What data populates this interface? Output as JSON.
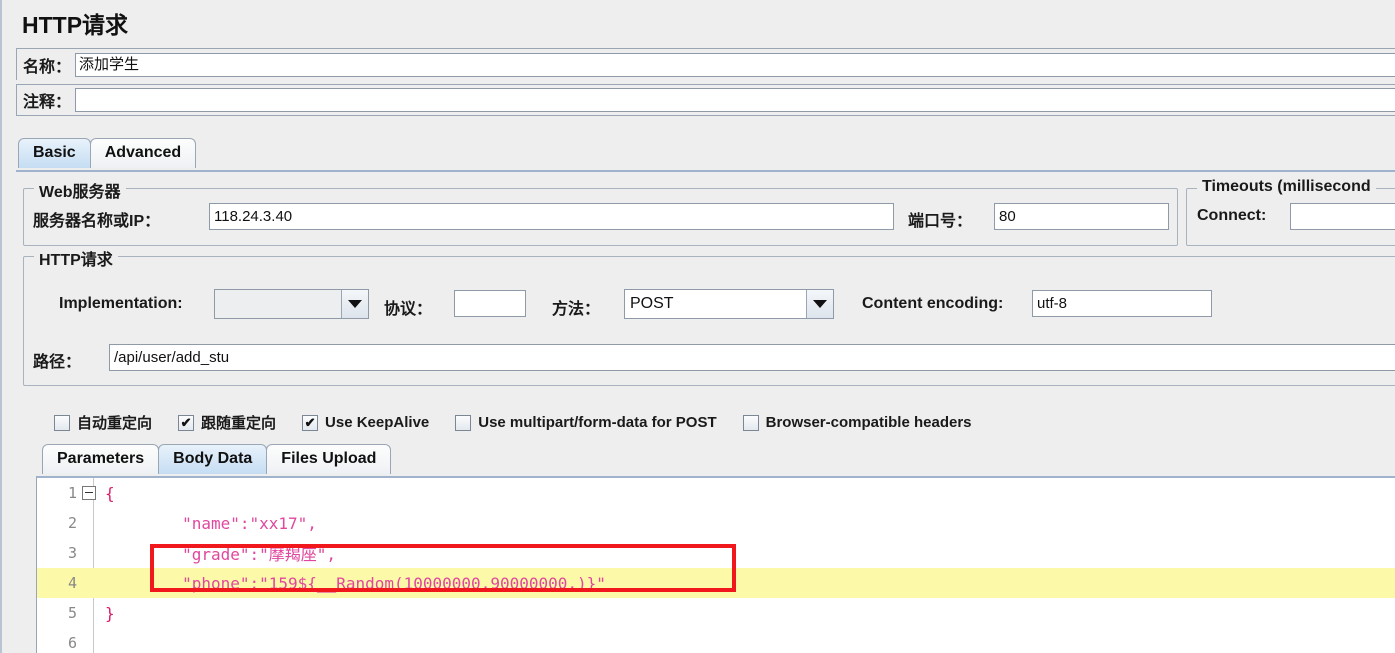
{
  "page_title": "HTTP请求",
  "fields": {
    "name_label": "名称：",
    "name_value": "添加学生",
    "comment_label": "注释：",
    "comment_value": ""
  },
  "main_tabs": [
    {
      "label": "Basic",
      "selected": true
    },
    {
      "label": "Advanced",
      "selected": false
    }
  ],
  "web_server": {
    "group_title": "Web服务器",
    "server_label": "服务器名称或IP：",
    "server_value": "118.24.3.40",
    "port_label": "端口号：",
    "port_value": "80"
  },
  "timeouts": {
    "group_title": "Timeouts (millisecond",
    "connect_label": "Connect:",
    "connect_value": ""
  },
  "http_request": {
    "group_title": "HTTP请求",
    "implementation_label": "Implementation:",
    "implementation_value": "",
    "protocol_label": "协议：",
    "protocol_value": "",
    "method_label": "方法：",
    "method_value": "POST",
    "content_encoding_label": "Content encoding:",
    "content_encoding_value": "utf-8",
    "path_label": "路径：",
    "path_value": "/api/user/add_stu",
    "checkboxes": [
      {
        "label": "自动重定向",
        "checked": false
      },
      {
        "label": "跟随重定向",
        "checked": true
      },
      {
        "label": "Use KeepAlive",
        "checked": true
      },
      {
        "label": "Use multipart/form-data for POST",
        "checked": false
      },
      {
        "label": "Browser-compatible headers",
        "checked": false
      }
    ]
  },
  "body_tabs": [
    {
      "label": "Parameters",
      "selected": false
    },
    {
      "label": "Body Data",
      "selected": true
    },
    {
      "label": "Files Upload",
      "selected": false
    }
  ],
  "editor": {
    "lines": [
      {
        "no": "1",
        "text": "{",
        "fold": true,
        "highlight": false
      },
      {
        "no": "2",
        "text": "        \"name\":\"xx17\",",
        "fold": false,
        "highlight": false
      },
      {
        "no": "3",
        "text": "        \"grade\":\"摩羯座\",",
        "fold": false,
        "highlight": false
      },
      {
        "no": "4",
        "text": "        \"phone\":\"159${__Random(10000000,90000000,)}\"",
        "fold": false,
        "highlight": true
      },
      {
        "no": "5",
        "text": "}",
        "fold": false,
        "highlight": false
      },
      {
        "no": "6",
        "text": "",
        "fold": false,
        "highlight": false
      }
    ]
  },
  "colors": {
    "annotation": "#f0181c",
    "highlight": "#fcf9a8",
    "code_string": "#e0479e",
    "tab_selected": "#c5ddf3"
  },
  "icons": {
    "combo_arrow": "chevron-down-icon",
    "fold": "collapse-icon",
    "check": "✔"
  }
}
